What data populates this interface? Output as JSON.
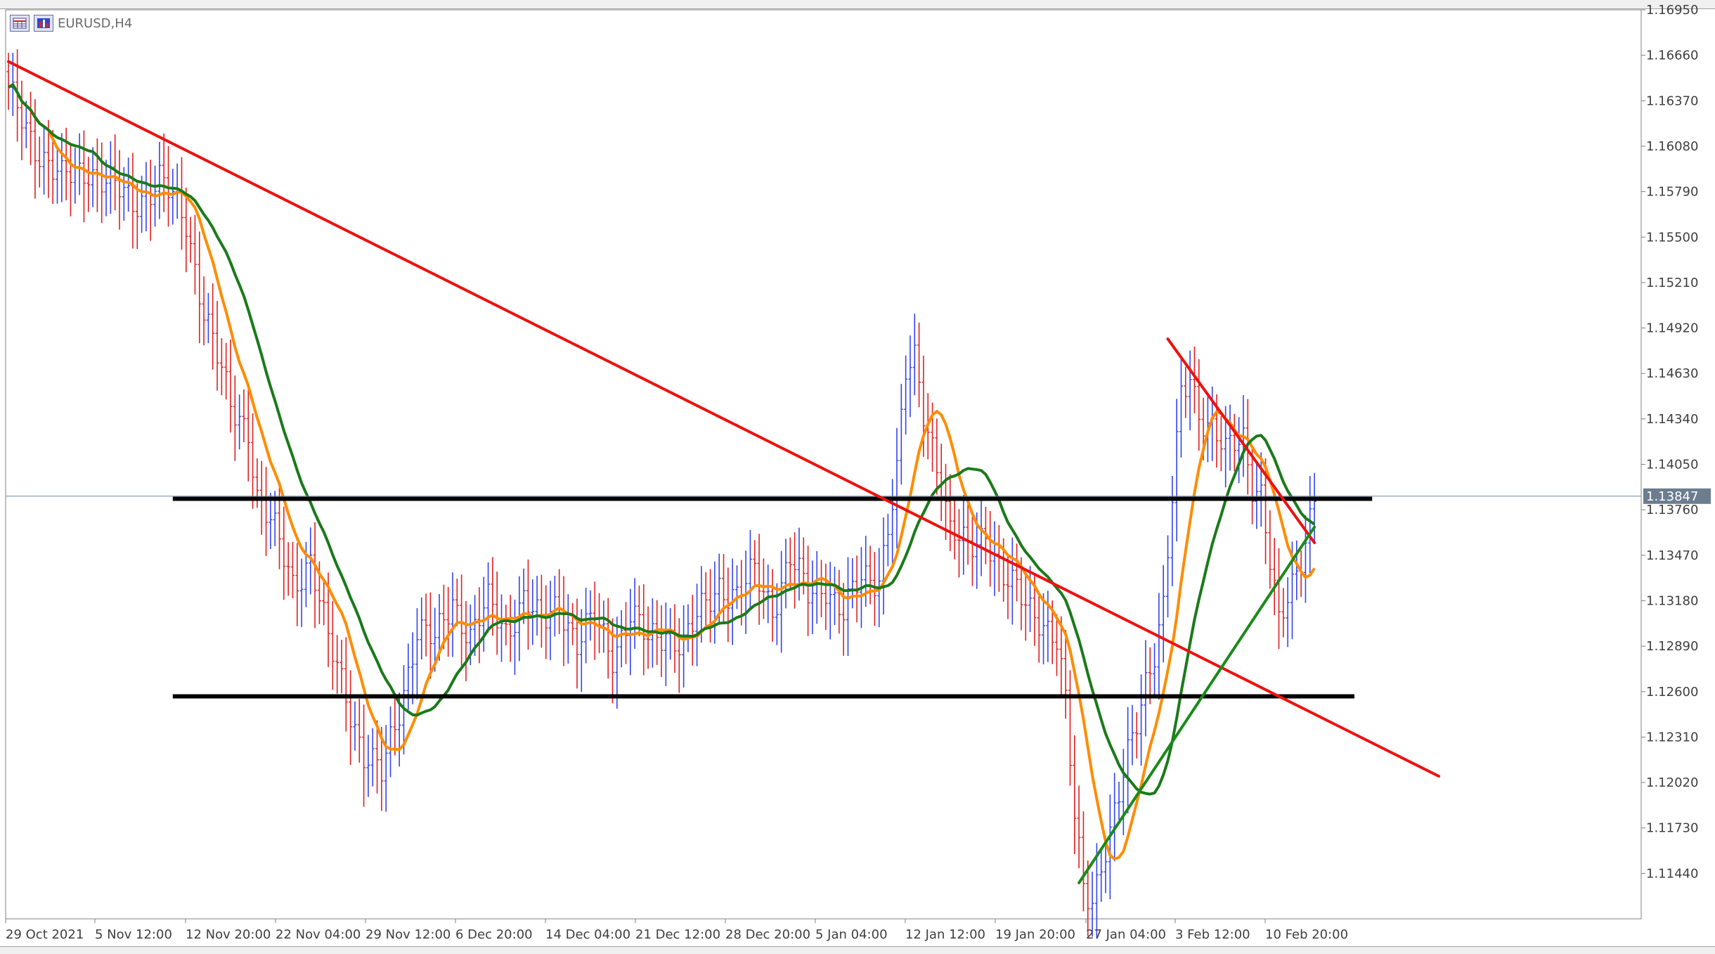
{
  "window": {
    "title": "EURUSD,H4"
  },
  "colors": {
    "background": "#ffffff",
    "axis": "#808080",
    "bull": "#3344ee",
    "bear": "#e02020",
    "ma_fast": "#ff8c00",
    "ma_slow": "#1a7a1a",
    "trend_down": "#ee1111",
    "trend_up": "#1a8a1a",
    "level": "#000000",
    "price_line": "#6a8aaa",
    "price_label_bg": "#6b7d8f",
    "price_label_text": "#ffffff"
  },
  "icons": {
    "chart_icon_1": "table-chart-icon",
    "chart_icon_2": "bar-chart-icon"
  },
  "chart_data": {
    "type": "candlestick",
    "symbol": "EURUSD",
    "timeframe": "H4",
    "y_axis": {
      "min": 1.1115,
      "max": 1.1695,
      "ticks": [
        "1.16950",
        "1.16660",
        "1.16370",
        "1.16080",
        "1.15790",
        "1.15500",
        "1.15210",
        "1.14920",
        "1.14630",
        "1.14340",
        "1.14050",
        "1.13760",
        "1.13470",
        "1.13180",
        "1.12890",
        "1.12600",
        "1.12310",
        "1.12020",
        "1.11730",
        "1.11440"
      ]
    },
    "x_axis": {
      "labels": [
        "29 Oct 2021",
        "5 Nov 12:00",
        "12 Nov 20:00",
        "22 Nov 04:00",
        "29 Nov 12:00",
        "6 Dec 20:00",
        "14 Dec 04:00",
        "21 Dec 12:00",
        "28 Dec 20:00",
        "5 Jan 04:00",
        "12 Jan 12:00",
        "19 Jan 20:00",
        "27 Jan 04:00",
        "3 Feb 12:00",
        "10 Feb 20:00"
      ]
    },
    "current_price": "1.13847",
    "price_path": [
      [
        0,
        1.164
      ],
      [
        6,
        1.161
      ],
      [
        12,
        1.1585
      ],
      [
        18,
        1.1595
      ],
      [
        24,
        1.158
      ],
      [
        28,
        1.1572
      ],
      [
        34,
        1.1586
      ],
      [
        40,
        1.156
      ],
      [
        44,
        1.1505
      ],
      [
        50,
        1.144
      ],
      [
        54,
        1.143
      ],
      [
        56,
        1.1385
      ],
      [
        60,
        1.136
      ],
      [
        64,
        1.133
      ],
      [
        68,
        1.1345
      ],
      [
        72,
        1.129
      ],
      [
        76,
        1.126
      ],
      [
        80,
        1.122
      ],
      [
        84,
        1.1205
      ],
      [
        88,
        1.125
      ],
      [
        92,
        1.13
      ],
      [
        96,
        1.129
      ],
      [
        100,
        1.132
      ],
      [
        104,
        1.1295
      ],
      [
        108,
        1.1315
      ],
      [
        112,
        1.13
      ],
      [
        116,
        1.132
      ],
      [
        120,
        1.13
      ],
      [
        124,
        1.132
      ],
      [
        128,
        1.129
      ],
      [
        132,
        1.1305
      ],
      [
        136,
        1.1285
      ],
      [
        140,
        1.131
      ],
      [
        144,
        1.129
      ],
      [
        148,
        1.13
      ],
      [
        152,
        1.129
      ],
      [
        156,
        1.131
      ],
      [
        160,
        1.133
      ],
      [
        164,
        1.132
      ],
      [
        168,
        1.1335
      ],
      [
        172,
        1.1315
      ],
      [
        176,
        1.1345
      ],
      [
        180,
        1.132
      ],
      [
        184,
        1.133
      ],
      [
        188,
        1.131
      ],
      [
        192,
        1.133
      ],
      [
        196,
        1.1335
      ],
      [
        200,
        1.14
      ],
      [
        202,
        1.146
      ],
      [
        204,
        1.147
      ],
      [
        206,
        1.144
      ],
      [
        208,
        1.142
      ],
      [
        210,
        1.1395
      ],
      [
        212,
        1.136
      ],
      [
        216,
        1.135
      ],
      [
        220,
        1.1365
      ],
      [
        224,
        1.133
      ],
      [
        228,
        1.132
      ],
      [
        232,
        1.131
      ],
      [
        236,
        1.129
      ],
      [
        238,
        1.125
      ],
      [
        240,
        1.118
      ],
      [
        242,
        1.114
      ],
      [
        244,
        1.113
      ],
      [
        246,
        1.115
      ],
      [
        248,
        1.1165
      ],
      [
        250,
        1.119
      ],
      [
        252,
        1.122
      ],
      [
        254,
        1.1245
      ],
      [
        256,
        1.127
      ],
      [
        258,
        1.1285
      ],
      [
        260,
        1.131
      ],
      [
        262,
        1.138
      ],
      [
        264,
        1.145
      ],
      [
        266,
        1.1465
      ],
      [
        268,
        1.144
      ],
      [
        270,
        1.143
      ],
      [
        272,
        1.142
      ],
      [
        274,
        1.141
      ],
      [
        276,
        1.142
      ],
      [
        278,
        1.1425
      ],
      [
        280,
        1.1395
      ],
      [
        282,
        1.1385
      ],
      [
        284,
        1.134
      ],
      [
        286,
        1.13
      ],
      [
        288,
        1.132
      ],
      [
        290,
        1.134
      ],
      [
        292,
        1.136
      ],
      [
        294,
        1.1384
      ]
    ],
    "series": [
      {
        "name": "",
        "type": "moving-average",
        "key": "ma_fast",
        "period": 10
      },
      {
        "name": "",
        "type": "moving-average",
        "key": "ma_slow",
        "period": 20
      }
    ],
    "drawings": {
      "trend_lines": [
        {
          "color": "trend_down",
          "from": [
            0,
            1.1662
          ],
          "to": [
            322,
            1.1206
          ]
        },
        {
          "color": "trend_down",
          "from": [
            261,
            1.1485
          ],
          "to": [
            294,
            1.1355
          ]
        },
        {
          "color": "trend_up",
          "from": [
            241,
            1.1138
          ],
          "to": [
            294,
            1.1365
          ]
        }
      ],
      "horizontal_lines": [
        {
          "color": "level",
          "price": 1.1383,
          "from_bar": 37,
          "to_bar": 307
        },
        {
          "color": "level",
          "price": 1.1257,
          "from_bar": 37,
          "to_bar": 303
        }
      ]
    }
  }
}
